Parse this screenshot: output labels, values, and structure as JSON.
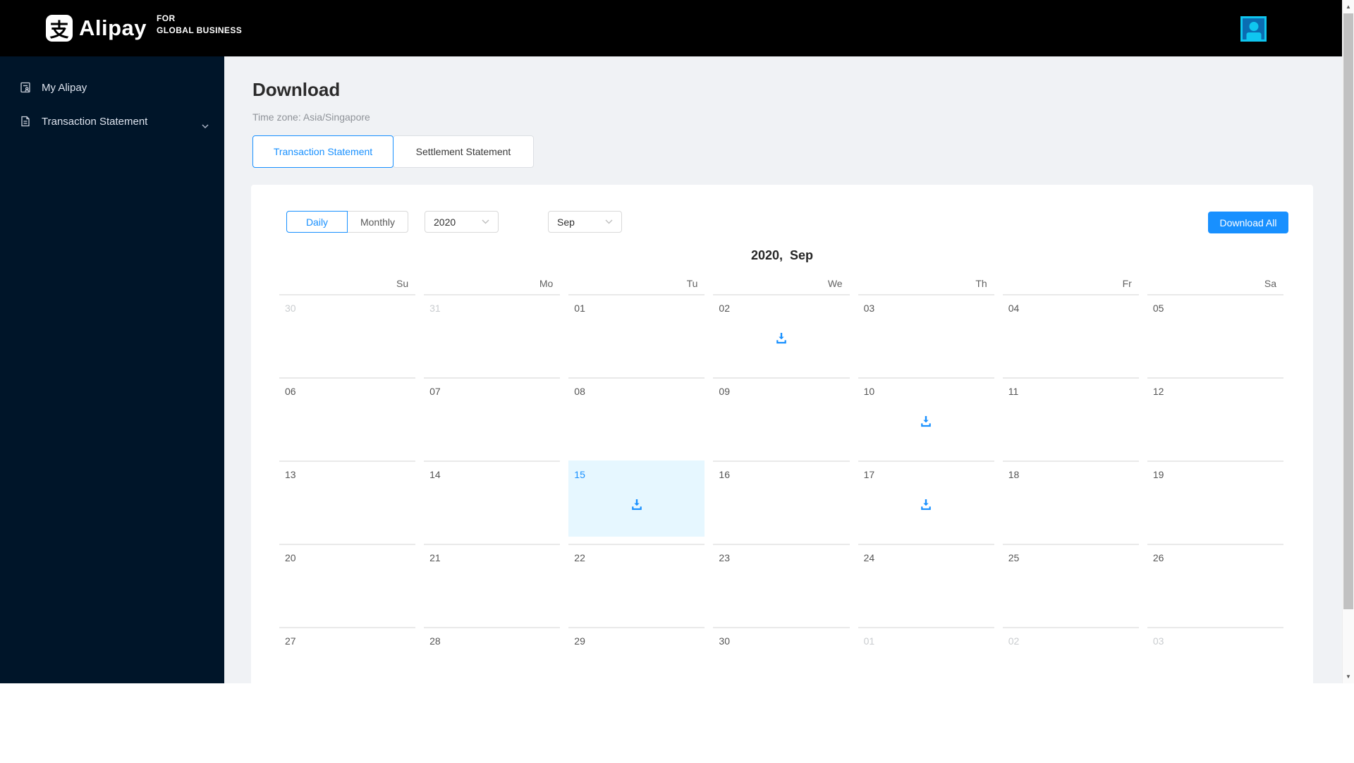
{
  "header": {
    "logo_glyph": "支",
    "brand": "Alipay",
    "brand_suffix_line1": "FOR",
    "brand_suffix_line2": "GLOBAL BUSINESS"
  },
  "sidebar": {
    "items": [
      {
        "label": "My Alipay",
        "icon": "id-card-icon",
        "expandable": false
      },
      {
        "label": "Transaction Statement",
        "icon": "document-icon",
        "expandable": true
      }
    ]
  },
  "page": {
    "title": "Download",
    "timezone": "Time zone: Asia/Singapore",
    "tabs": [
      {
        "label": "Transaction Statement",
        "active": true
      },
      {
        "label": "Settlement Statement",
        "active": false
      }
    ]
  },
  "toolbar": {
    "period_toggle": [
      {
        "label": "Daily",
        "active": true
      },
      {
        "label": "Monthly",
        "active": false
      }
    ],
    "year_select": "2020",
    "month_select": "Sep",
    "download_all_label": "Download All"
  },
  "calendar": {
    "title": "2020,  Sep",
    "day_headers": [
      "Su",
      "Mo",
      "Tu",
      "We",
      "Th",
      "Fr",
      "Sa"
    ],
    "weeks": [
      [
        {
          "day": "30",
          "muted": true
        },
        {
          "day": "31",
          "muted": true
        },
        {
          "day": "01"
        },
        {
          "day": "02",
          "download": true
        },
        {
          "day": "03"
        },
        {
          "day": "04"
        },
        {
          "day": "05"
        }
      ],
      [
        {
          "day": "06"
        },
        {
          "day": "07"
        },
        {
          "day": "08"
        },
        {
          "day": "09"
        },
        {
          "day": "10",
          "download": true
        },
        {
          "day": "11"
        },
        {
          "day": "12"
        }
      ],
      [
        {
          "day": "13"
        },
        {
          "day": "14"
        },
        {
          "day": "15",
          "download": true,
          "selected": true
        },
        {
          "day": "16"
        },
        {
          "day": "17",
          "download": true
        },
        {
          "day": "18"
        },
        {
          "day": "19"
        }
      ],
      [
        {
          "day": "20"
        },
        {
          "day": "21"
        },
        {
          "day": "22"
        },
        {
          "day": "23"
        },
        {
          "day": "24"
        },
        {
          "day": "25"
        },
        {
          "day": "26"
        }
      ],
      [
        {
          "day": "27"
        },
        {
          "day": "28"
        },
        {
          "day": "29"
        },
        {
          "day": "30"
        },
        {
          "day": "01",
          "muted": true
        },
        {
          "day": "02",
          "muted": true
        },
        {
          "day": "03",
          "muted": true
        }
      ]
    ]
  },
  "scrollbar": {
    "up_glyph": "▲",
    "down_glyph": "▼"
  },
  "colors": {
    "accent": "#1890ff",
    "selected_bg": "#e6f7ff",
    "sidebar_bg": "#001529",
    "header_bg": "#000000",
    "content_bg": "#f0f2f5",
    "avatar_cyan": "#0fc6f0",
    "avatar_bg": "#0a6cb2"
  }
}
